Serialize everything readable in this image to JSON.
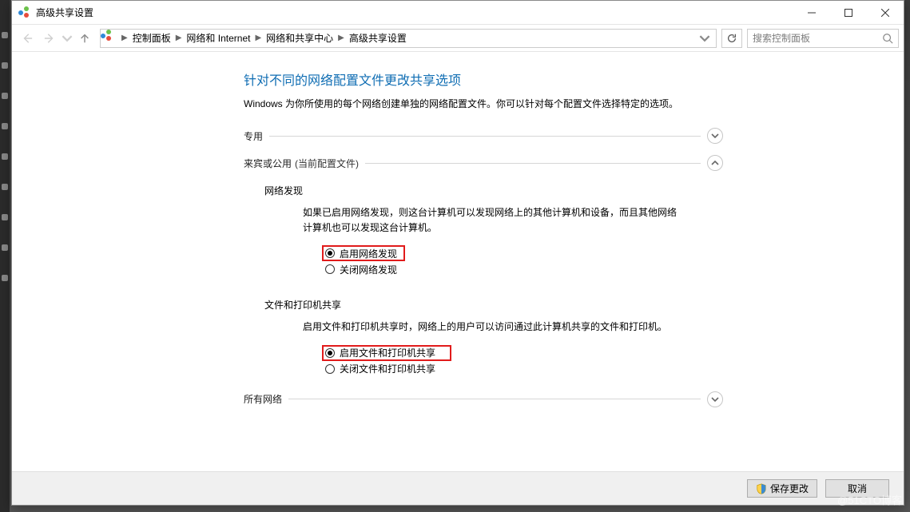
{
  "window": {
    "title": "高级共享设置"
  },
  "breadcrumbs": {
    "items": [
      "控制面板",
      "网络和 Internet",
      "网络和共享中心",
      "高级共享设置"
    ]
  },
  "search": {
    "placeholder": "搜索控制面板"
  },
  "page": {
    "heading": "针对不同的网络配置文件更改共享选项",
    "description": "Windows 为你所使用的每个网络创建单独的网络配置文件。你可以针对每个配置文件选择特定的选项。"
  },
  "sections": {
    "private": {
      "label": "专用",
      "expanded": false
    },
    "guest": {
      "label": "来宾或公用",
      "suffix": "(当前配置文件)",
      "expanded": true
    },
    "all": {
      "label": "所有网络",
      "expanded": false
    }
  },
  "guest": {
    "network_discovery": {
      "title": "网络发现",
      "desc": "如果已启用网络发现，则这台计算机可以发现网络上的其他计算机和设备，而且其他网络计算机也可以发现这台计算机。",
      "opt_on": "启用网络发现",
      "opt_off": "关闭网络发现",
      "selected": "on"
    },
    "file_printer": {
      "title": "文件和打印机共享",
      "desc": "启用文件和打印机共享时，网络上的用户可以访问通过此计算机共享的文件和打印机。",
      "opt_on": "启用文件和打印机共享",
      "opt_off": "关闭文件和打印机共享",
      "selected": "on"
    }
  },
  "footer": {
    "save": "保存更改",
    "cancel": "取消"
  },
  "watermark": "@51CTO博客"
}
